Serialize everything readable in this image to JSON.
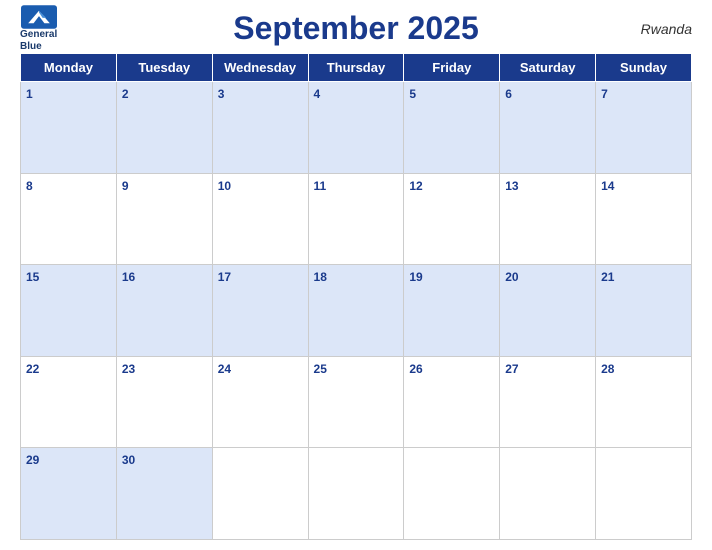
{
  "header": {
    "title": "September 2025",
    "country": "Rwanda",
    "logo_line1": "General",
    "logo_line2": "Blue"
  },
  "days_of_week": [
    "Monday",
    "Tuesday",
    "Wednesday",
    "Thursday",
    "Friday",
    "Saturday",
    "Sunday"
  ],
  "weeks": [
    [
      1,
      2,
      3,
      4,
      5,
      6,
      7
    ],
    [
      8,
      9,
      10,
      11,
      12,
      13,
      14
    ],
    [
      15,
      16,
      17,
      18,
      19,
      20,
      21
    ],
    [
      22,
      23,
      24,
      25,
      26,
      27,
      28
    ],
    [
      29,
      30,
      null,
      null,
      null,
      null,
      null
    ]
  ]
}
